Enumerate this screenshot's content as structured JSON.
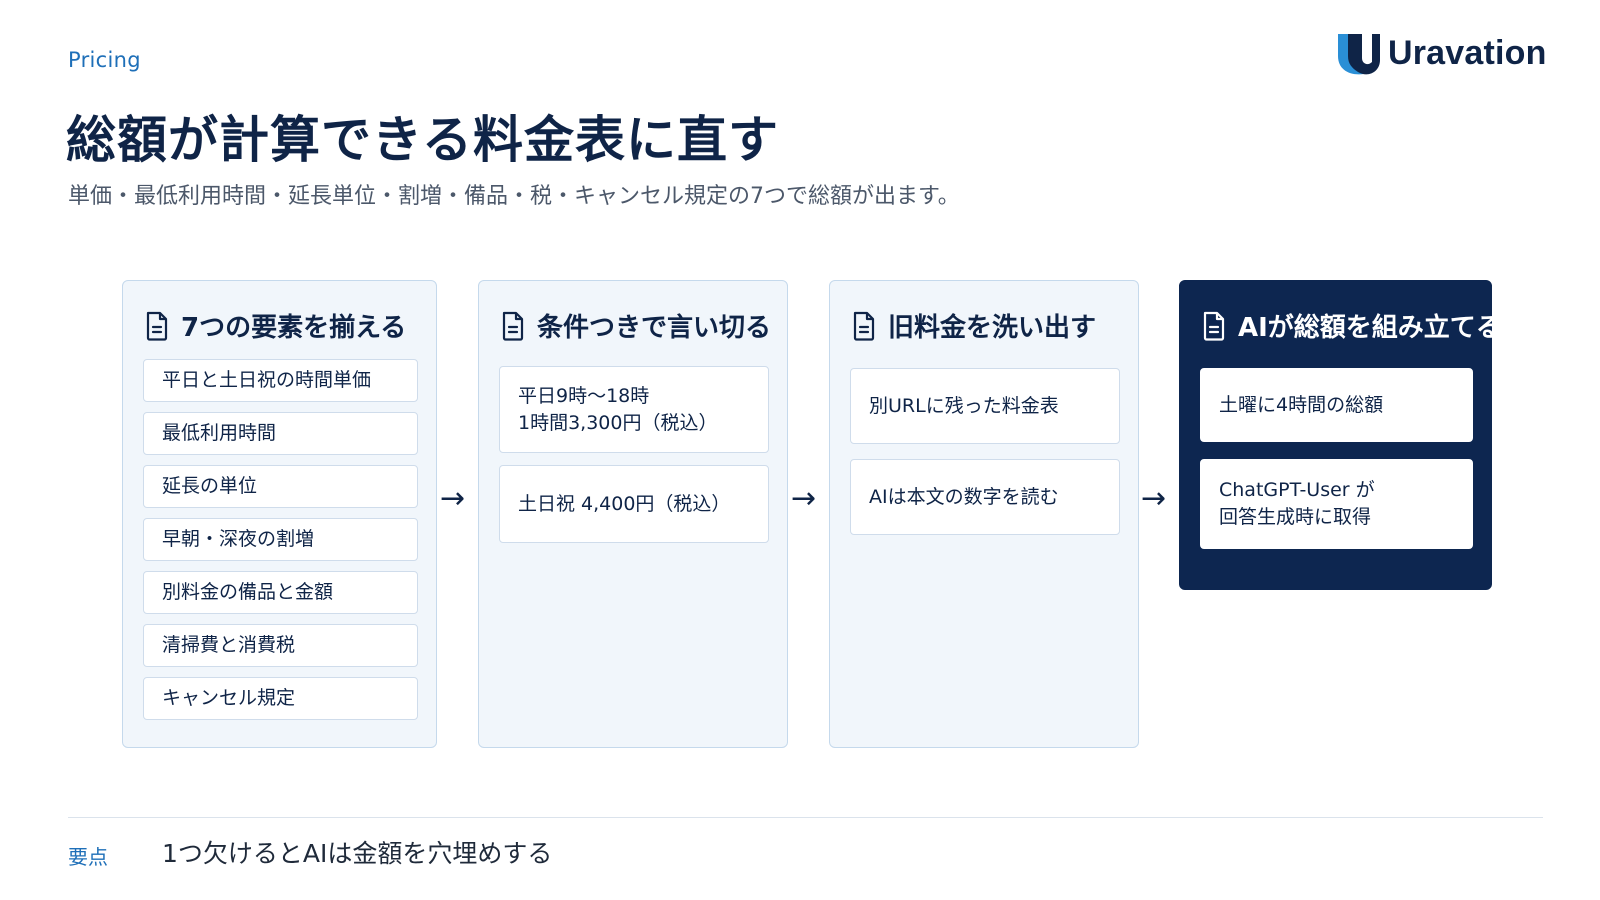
{
  "header": {
    "eyebrow": "Pricing",
    "title": "総額が計算できる料金表に直す",
    "subtitle": "単価・最低利用時間・延長単位・割増・備品・税・キャンセル規定の7つで総額が出ます。",
    "logo_text": "Uravation"
  },
  "panels": [
    {
      "title": "7つの要素を揃える",
      "items": [
        "平日と土日祝の時間単価",
        "最低利用時間",
        "延長の単位",
        "早朝・深夜の割増",
        "別料金の備品と金額",
        "清掃費と消費税",
        "キャンセル規定"
      ]
    },
    {
      "title": "条件つきで言い切る",
      "items": [
        "平日9時〜18時\n1時間3,300円（税込）",
        "土日祝 4,400円（税込）"
      ]
    },
    {
      "title": "旧料金を洗い出す",
      "items": [
        "別URLに残った料金表",
        "AIは本文の数字を読む"
      ]
    },
    {
      "title": "AIが総額を組み立てる",
      "items": [
        "土曜に4時間の総額",
        "ChatGPT-User が\n回答生成時に取得"
      ]
    }
  ],
  "arrow_glyph": "→",
  "key_point": {
    "label": "要点",
    "text": "1つ欠けるとAIは金額を穴埋めする"
  },
  "colors": {
    "navy": "#0d2650",
    "accent_blue": "#1e6fb8",
    "panel_bg": "#f1f6fb"
  }
}
